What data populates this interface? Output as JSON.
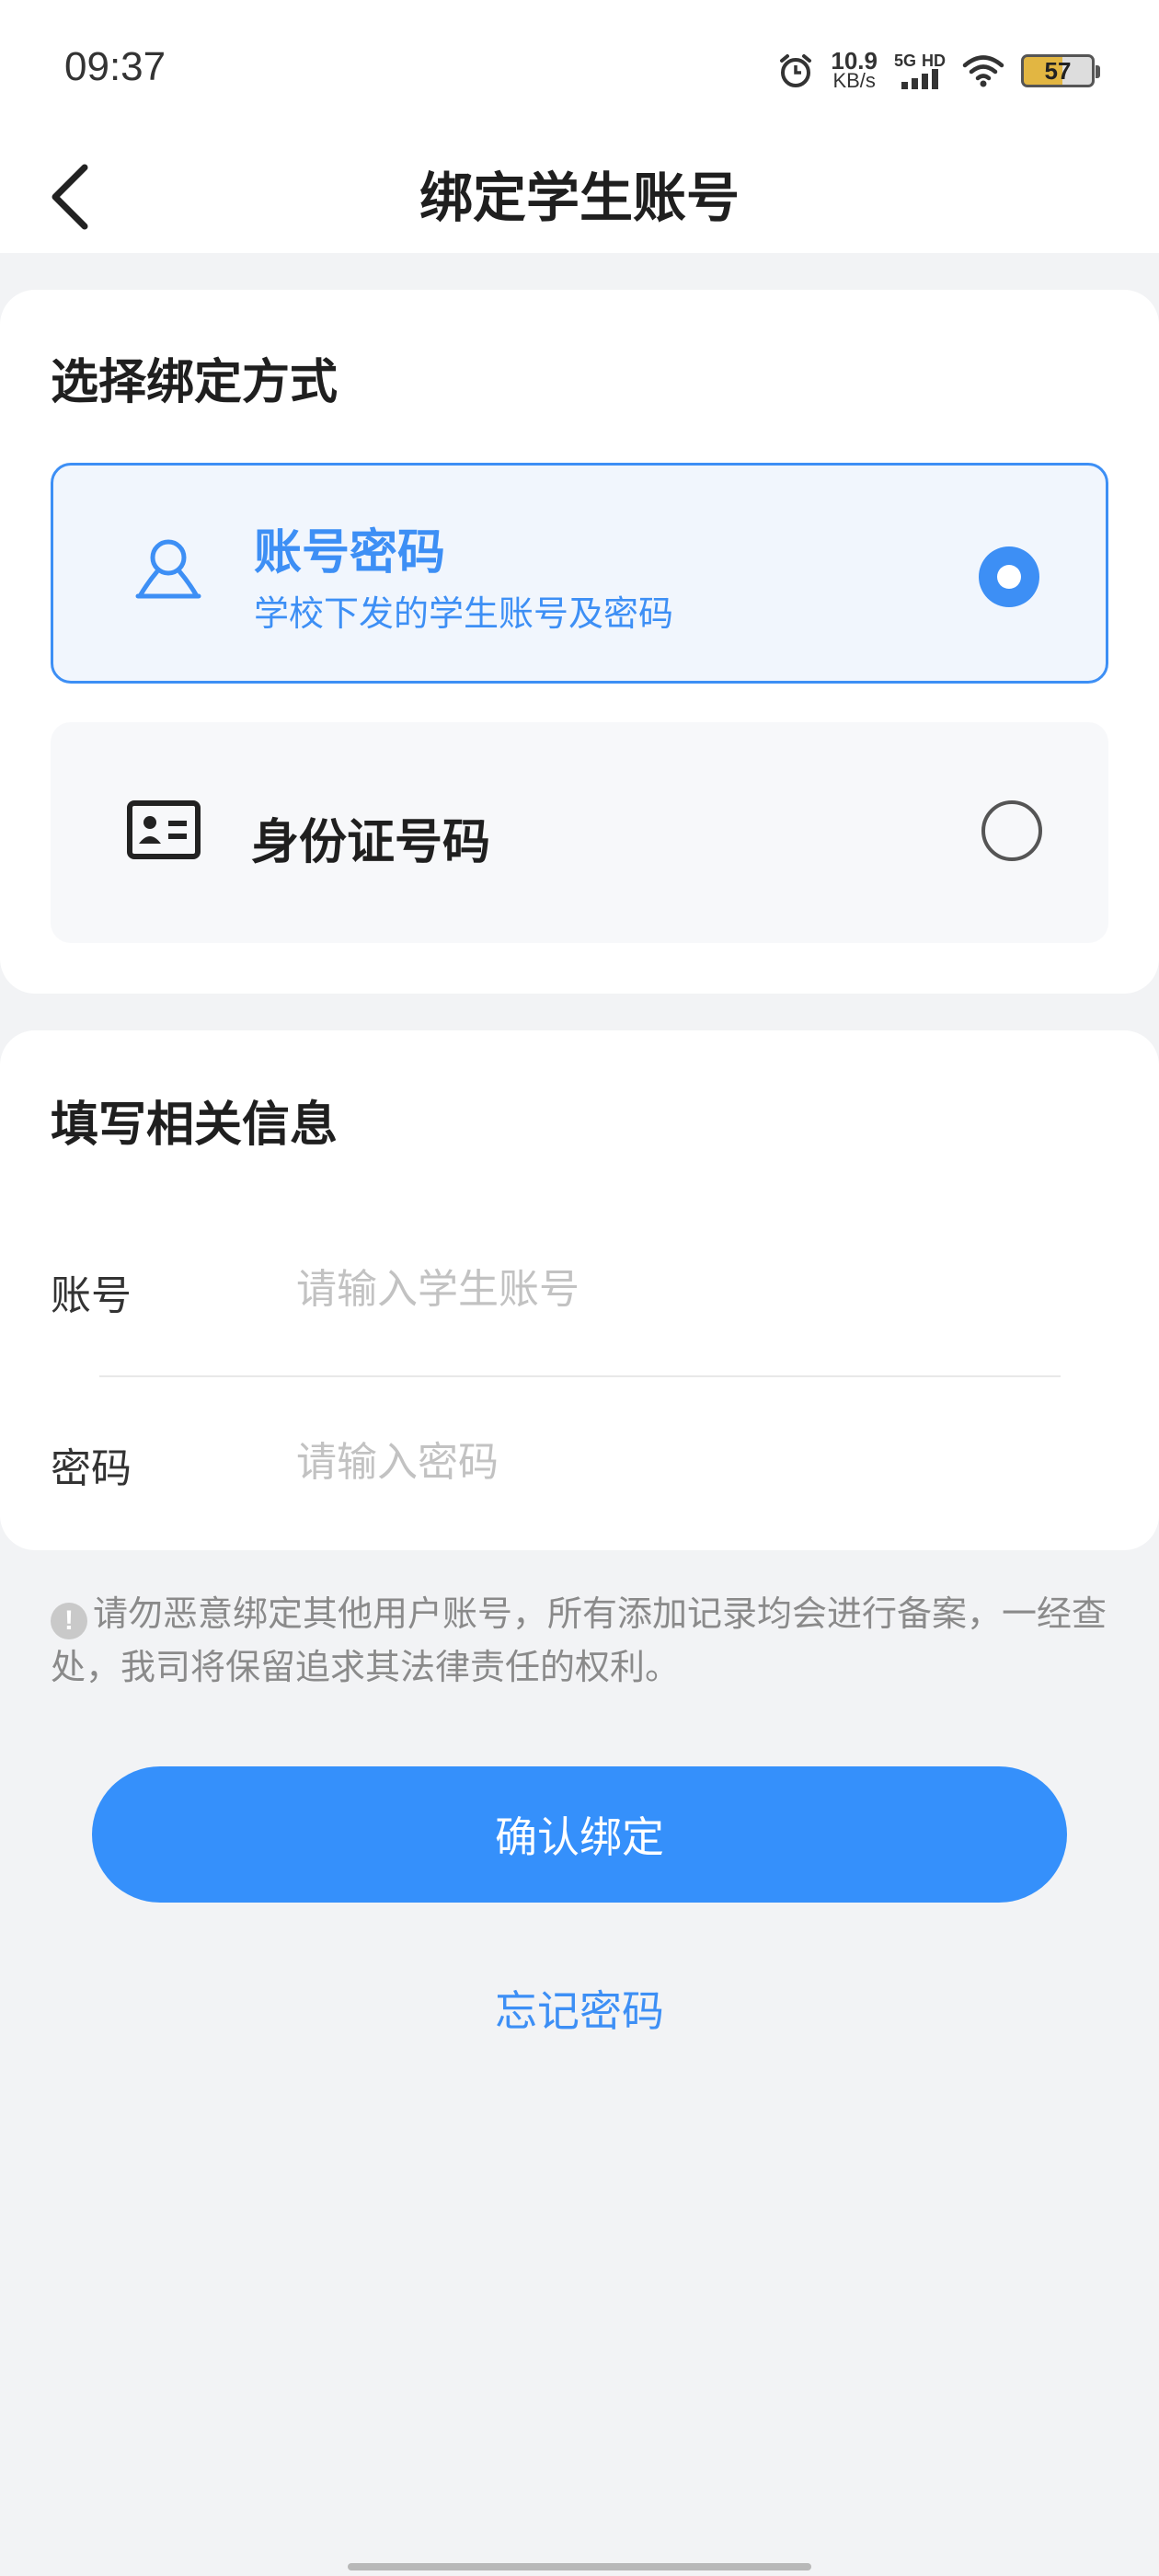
{
  "status_bar": {
    "time": "09:37",
    "net_speed_value": "10.9",
    "net_speed_unit": "KB/s",
    "network_type": "5G",
    "network_hd": "HD",
    "battery_level": "57"
  },
  "header": {
    "title": "绑定学生账号"
  },
  "bind_method": {
    "section_title": "选择绑定方式",
    "options": [
      {
        "title": "账号密码",
        "subtitle": "学校下发的学生账号及密码",
        "selected": true
      },
      {
        "title": "身份证号码",
        "selected": false
      }
    ]
  },
  "info": {
    "section_title": "填写相关信息",
    "fields": [
      {
        "label": "账号",
        "placeholder": "请输入学生账号",
        "value": ""
      },
      {
        "label": "密码",
        "placeholder": "请输入密码",
        "value": ""
      }
    ]
  },
  "notice": {
    "icon_glyph": "!",
    "text": "请勿恶意绑定其他用户账号，所有添加记录均会进行备案，一经查处，我司将保留追求其法律责任的权利。"
  },
  "actions": {
    "confirm_label": "确认绑定",
    "forgot_label": "忘记密码"
  },
  "colors": {
    "accent": "#3d8ff5",
    "button": "#3590fb",
    "background": "#f2f3f5"
  }
}
